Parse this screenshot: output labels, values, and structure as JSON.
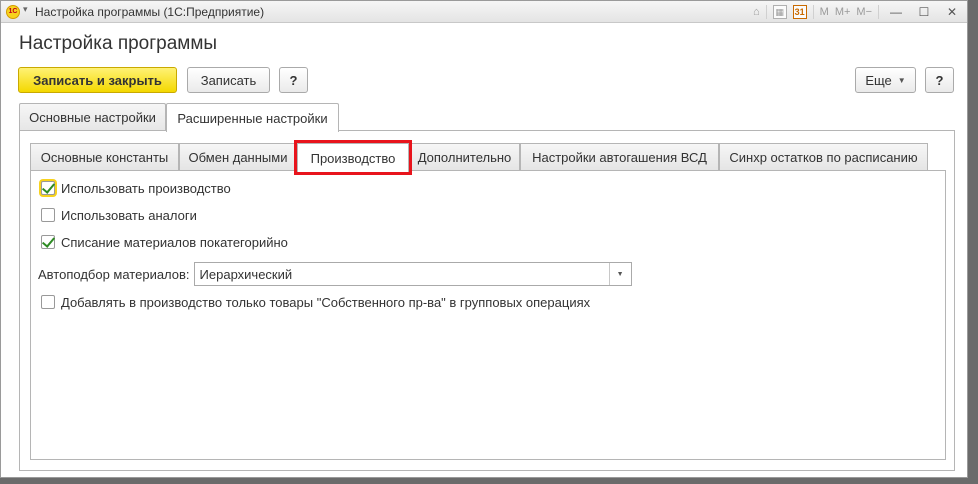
{
  "window": {
    "title": "Настройка программы  (1С:Предприятие)",
    "logo_text": "1С",
    "toolbar_icons": [
      "home-icon",
      "calculator-icon",
      "calendar-icon",
      "memory-m-icon",
      "memory-mplus-icon",
      "memory-mminus-icon",
      "minimize-icon",
      "maximize-icon",
      "close-icon"
    ],
    "calendar_label": "31",
    "m_label": "M",
    "m_plus_label": "M+",
    "m_minus_label": "M−",
    "minimize_glyph": "—",
    "maximize_glyph": "☐",
    "close_glyph": "✕"
  },
  "form": {
    "title": "Настройка программы"
  },
  "toolbar": {
    "save_close_label": "Записать и закрыть",
    "save_label": "Записать",
    "help_label": "?",
    "more_label": "Еще",
    "help2_label": "?"
  },
  "outer_tabs": [
    {
      "label": "Основные настройки",
      "active": false
    },
    {
      "label": "Расширенные настройки",
      "active": true
    }
  ],
  "inner_tabs": [
    {
      "label": "Основные константы",
      "active": false
    },
    {
      "label": "Обмен данными",
      "active": false
    },
    {
      "label": "Производство",
      "active": true
    },
    {
      "label": "Дополнительно",
      "active": false
    },
    {
      "label": "Настройки автогашения ВСД",
      "active": false
    },
    {
      "label": "Синхр остатков по расписанию",
      "active": false
    }
  ],
  "production": {
    "use_production": {
      "label": "Использовать производство",
      "checked": true
    },
    "use_analogs": {
      "label": "Использовать аналоги",
      "checked": false
    },
    "write_off_by_category": {
      "label": "Списание материалов покатегорийно",
      "checked": true
    },
    "autoselect": {
      "label": "Автоподбор материалов:",
      "value": "Иерархический"
    },
    "add_own_goods_only": {
      "label": "Добавлять в производство только товары  \"Собственного пр-ва\" в групповых операциях",
      "checked": false
    }
  },
  "colors": {
    "primary_button": "#f4d800",
    "highlight_frame": "#e8141c",
    "checkmark": "#2e8b24"
  }
}
